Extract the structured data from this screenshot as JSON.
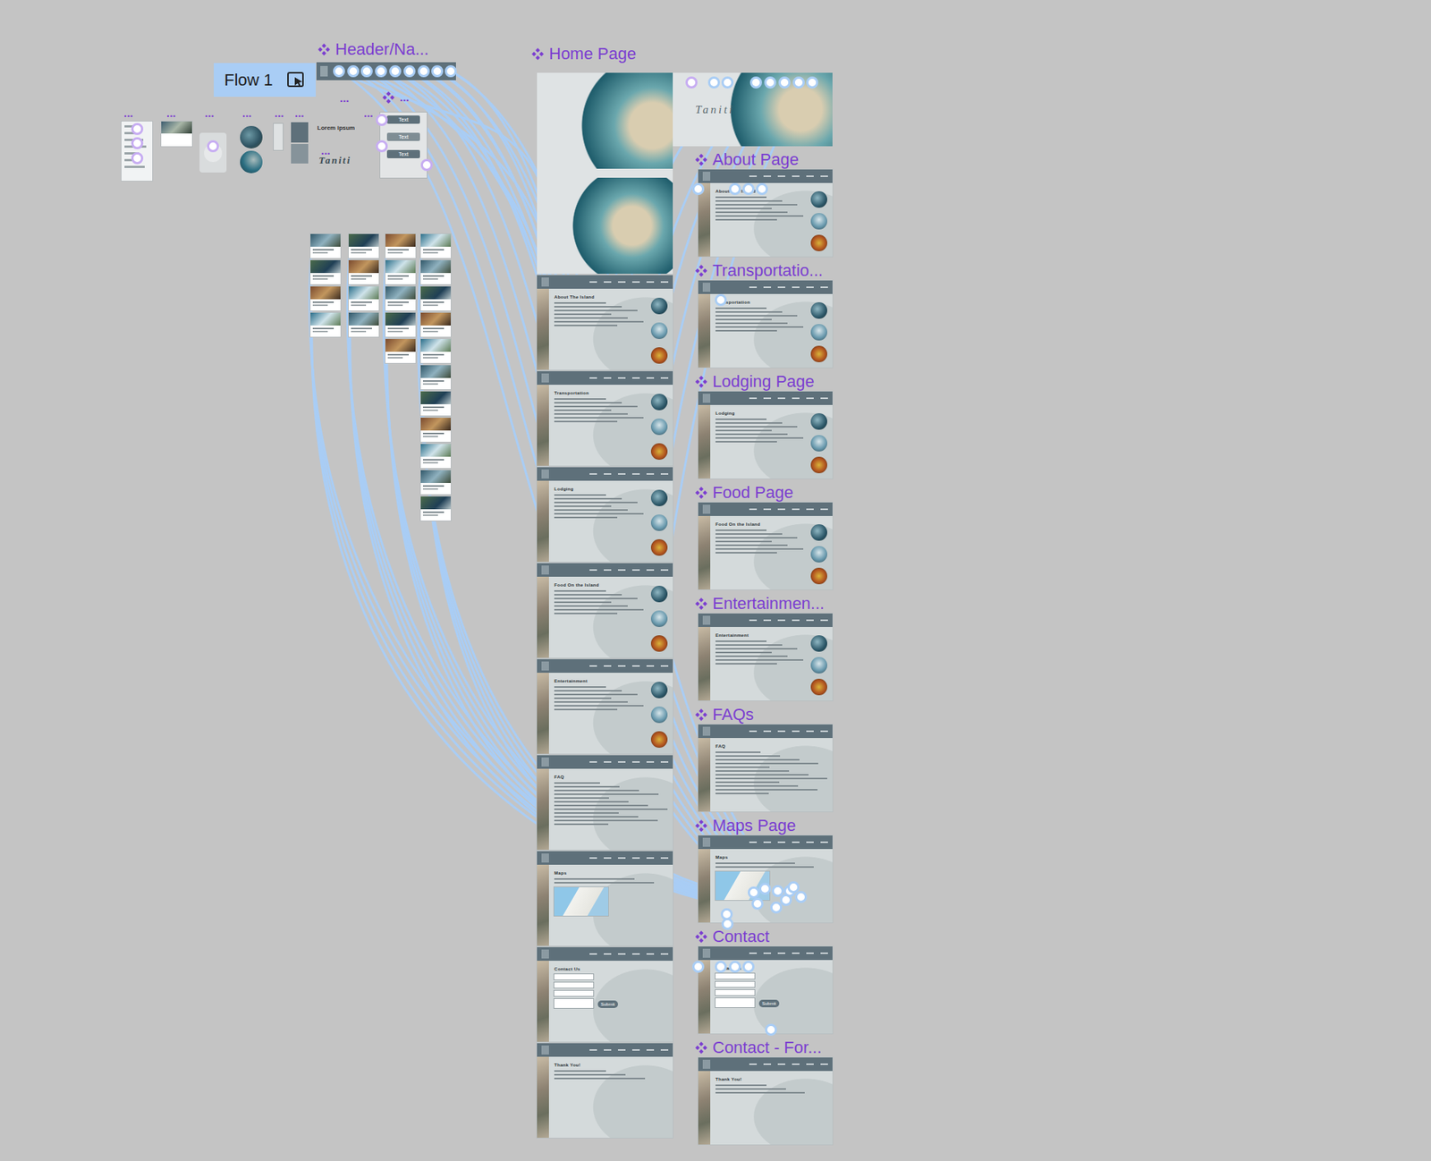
{
  "canvas": {
    "flow": {
      "label": "Flow 1"
    },
    "header_component": {
      "label": "Header/Na..."
    },
    "component_set": {
      "label": "..."
    },
    "ellipsis_labels": [
      "...",
      "...",
      "...",
      "...",
      "...",
      "...",
      "...",
      "...",
      "..."
    ],
    "text_sample": "Lorem ipsum",
    "logo_sample": "Taniti",
    "button_variants": [
      "Text",
      "Text",
      "Text"
    ],
    "home_page": {
      "label": "Home Page",
      "hero_logo": "Taniti",
      "sections": [
        {
          "heading": "About The Island",
          "kind": "content"
        },
        {
          "heading": "Transportation",
          "kind": "content"
        },
        {
          "heading": "Lodging",
          "kind": "content"
        },
        {
          "heading": "Food On the Island",
          "kind": "content"
        },
        {
          "heading": "Entertainment",
          "kind": "content"
        },
        {
          "heading": "FAQ",
          "kind": "faq"
        },
        {
          "heading": "Maps",
          "kind": "map"
        },
        {
          "heading": "Contact Us",
          "kind": "form",
          "button": "Submit"
        },
        {
          "heading": "Thank You!",
          "kind": "thanks"
        }
      ]
    },
    "pages": [
      {
        "label": "About Page",
        "heading": "About The Island",
        "kind": "content"
      },
      {
        "label": "Transportatio...",
        "heading": "Transportation",
        "kind": "content"
      },
      {
        "label": "Lodging Page",
        "heading": "Lodging",
        "kind": "content"
      },
      {
        "label": "Food Page",
        "heading": "Food On the Island",
        "kind": "content"
      },
      {
        "label": "Entertainmen...",
        "heading": "Entertainment",
        "kind": "content"
      },
      {
        "label": "FAQs",
        "heading": "FAQ",
        "kind": "faq"
      },
      {
        "label": "Maps Page",
        "heading": "Maps",
        "kind": "map"
      },
      {
        "label": "Contact",
        "heading": "Contact Us",
        "kind": "form",
        "button": "Submit"
      },
      {
        "label": "Contact - For...",
        "heading": "Thank You!",
        "kind": "thanks"
      }
    ]
  }
}
